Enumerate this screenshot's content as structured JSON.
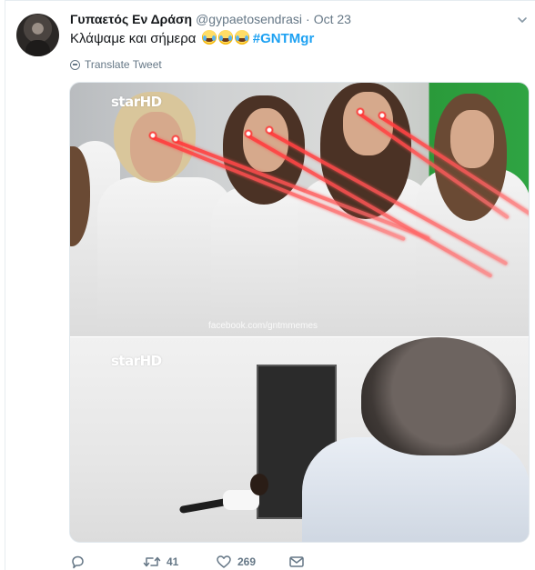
{
  "tweet": {
    "display_name": "Γυπαετός Εν Δράση",
    "handle": "@gypaetosendrasi",
    "separator": "·",
    "time": "Oct 23",
    "text": "Κλάψαμε και σήμερα",
    "hashtag": "#GNTMgr",
    "emojis": [
      "face-with-tears-of-joy",
      "face-with-tears-of-joy",
      "face-with-tears-of-joy"
    ],
    "translate_label": "Translate Tweet"
  },
  "media": {
    "top_panel": {
      "logo_text": "starHD",
      "watermark": "facebook.com/gntmmemes"
    },
    "bottom_panel": {
      "logo_text": "starHD"
    }
  },
  "actions": {
    "reply_icon": "reply-icon",
    "retweet_icon": "retweet-icon",
    "retweet_count": "41",
    "like_icon": "heart-icon",
    "like_count": "269",
    "dm_icon": "envelope-icon"
  },
  "colors": {
    "link": "#1da1f2",
    "secondary_text": "#657786",
    "primary_text": "#14171a",
    "laser": "#ff3c3c",
    "like": "#e0245e",
    "retweet": "#17bf63"
  }
}
